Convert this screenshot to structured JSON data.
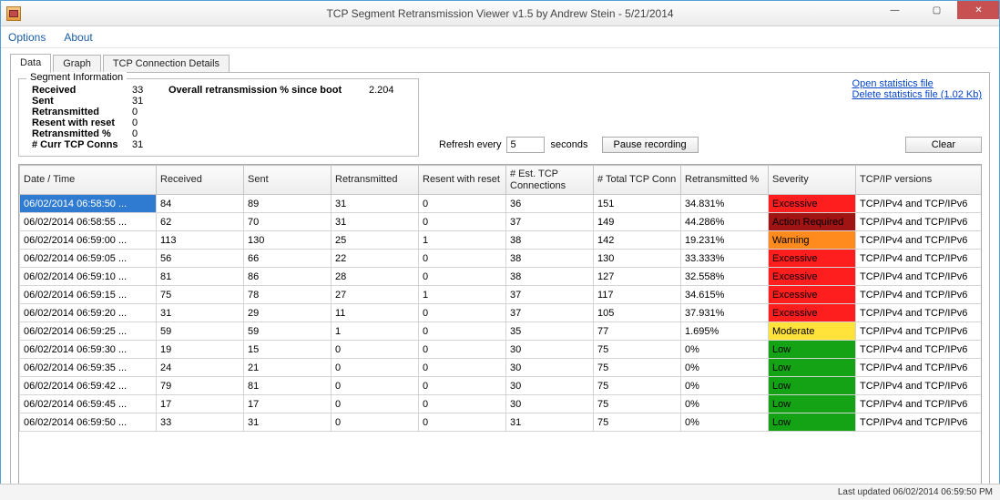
{
  "window": {
    "title": "TCP Segment Retransmission Viewer v1.5 by Andrew Stein - 5/21/2014"
  },
  "menu": {
    "options": "Options",
    "about": "About"
  },
  "tabs": {
    "data": "Data",
    "graph": "Graph",
    "details": "TCP Connection Details"
  },
  "segment_info": {
    "legend": "Segment Information",
    "labels": {
      "received": "Received",
      "sent": "Sent",
      "retransmitted": "Retransmitted",
      "resent_reset": "Resent with reset",
      "retransmitted_pct": "Retransmitted %",
      "curr_conns": "# Curr TCP Conns",
      "overall": "Overall retransmission % since boot"
    },
    "values": {
      "received": "33",
      "sent": "31",
      "retransmitted": "0",
      "resent_reset": "0",
      "retransmitted_pct": "0",
      "curr_conns": "31",
      "overall": "2.204"
    }
  },
  "links": {
    "open": "Open statistics file",
    "delete": "Delete statistics file (1.02 Kb)"
  },
  "refresh": {
    "label_before": "Refresh every",
    "value": "5",
    "label_after": "seconds",
    "pause": "Pause recording",
    "clear": "Clear"
  },
  "columns": {
    "datetime": "Date / Time",
    "received": "Received",
    "sent": "Sent",
    "retransmitted": "Retransmitted",
    "resent_reset": "Resent with reset",
    "est_conn": "# Est. TCP Connections",
    "total_conn": "# Total TCP Conn",
    "retransmitted_pct": "Retransmitted %",
    "severity": "Severity",
    "versions": "TCP/IP versions"
  },
  "severity_colors": {
    "Excessive": "sev-excessive",
    "Action Required": "sev-action",
    "Warning": "sev-warning",
    "Moderate": "sev-moderate",
    "Low": "sev-low"
  },
  "rows": [
    {
      "dt": "06/02/2014 06:58:50 ...",
      "rx": "84",
      "tx": "89",
      "re": "31",
      "rr": "0",
      "est": "36",
      "tot": "151",
      "pct": "34.831%",
      "sev": "Excessive",
      "ver": "TCP/IPv4 and TCP/IPv6",
      "selected": true
    },
    {
      "dt": "06/02/2014 06:58:55 ...",
      "rx": "62",
      "tx": "70",
      "re": "31",
      "rr": "0",
      "est": "37",
      "tot": "149",
      "pct": "44.286%",
      "sev": "Action Required",
      "ver": "TCP/IPv4 and TCP/IPv6"
    },
    {
      "dt": "06/02/2014 06:59:00 ...",
      "rx": "113",
      "tx": "130",
      "re": "25",
      "rr": "1",
      "est": "38",
      "tot": "142",
      "pct": "19.231%",
      "sev": "Warning",
      "ver": "TCP/IPv4 and TCP/IPv6"
    },
    {
      "dt": "06/02/2014 06:59:05 ...",
      "rx": "56",
      "tx": "66",
      "re": "22",
      "rr": "0",
      "est": "38",
      "tot": "130",
      "pct": "33.333%",
      "sev": "Excessive",
      "ver": "TCP/IPv4 and TCP/IPv6"
    },
    {
      "dt": "06/02/2014 06:59:10 ...",
      "rx": "81",
      "tx": "86",
      "re": "28",
      "rr": "0",
      "est": "38",
      "tot": "127",
      "pct": "32.558%",
      "sev": "Excessive",
      "ver": "TCP/IPv4 and TCP/IPv6"
    },
    {
      "dt": "06/02/2014 06:59:15 ...",
      "rx": "75",
      "tx": "78",
      "re": "27",
      "rr": "1",
      "est": "37",
      "tot": "117",
      "pct": "34.615%",
      "sev": "Excessive",
      "ver": "TCP/IPv4 and TCP/IPv6"
    },
    {
      "dt": "06/02/2014 06:59:20 ...",
      "rx": "31",
      "tx": "29",
      "re": "11",
      "rr": "0",
      "est": "37",
      "tot": "105",
      "pct": "37.931%",
      "sev": "Excessive",
      "ver": "TCP/IPv4 and TCP/IPv6"
    },
    {
      "dt": "06/02/2014 06:59:25 ...",
      "rx": "59",
      "tx": "59",
      "re": "1",
      "rr": "0",
      "est": "35",
      "tot": "77",
      "pct": "1.695%",
      "sev": "Moderate",
      "ver": "TCP/IPv4 and TCP/IPv6"
    },
    {
      "dt": "06/02/2014 06:59:30 ...",
      "rx": "19",
      "tx": "15",
      "re": "0",
      "rr": "0",
      "est": "30",
      "tot": "75",
      "pct": "0%",
      "sev": "Low",
      "ver": "TCP/IPv4 and TCP/IPv6"
    },
    {
      "dt": "06/02/2014 06:59:35 ...",
      "rx": "24",
      "tx": "21",
      "re": "0",
      "rr": "0",
      "est": "30",
      "tot": "75",
      "pct": "0%",
      "sev": "Low",
      "ver": "TCP/IPv4 and TCP/IPv6"
    },
    {
      "dt": "06/02/2014 06:59:42 ...",
      "rx": "79",
      "tx": "81",
      "re": "0",
      "rr": "0",
      "est": "30",
      "tot": "75",
      "pct": "0%",
      "sev": "Low",
      "ver": "TCP/IPv4 and TCP/IPv6"
    },
    {
      "dt": "06/02/2014 06:59:45 ...",
      "rx": "17",
      "tx": "17",
      "re": "0",
      "rr": "0",
      "est": "30",
      "tot": "75",
      "pct": "0%",
      "sev": "Low",
      "ver": "TCP/IPv4 and TCP/IPv6"
    },
    {
      "dt": "06/02/2014 06:59:50 ...",
      "rx": "33",
      "tx": "31",
      "re": "0",
      "rr": "0",
      "est": "31",
      "tot": "75",
      "pct": "0%",
      "sev": "Low",
      "ver": "TCP/IPv4 and TCP/IPv6"
    }
  ],
  "status": "Last updated 06/02/2014 06:59:50 PM"
}
